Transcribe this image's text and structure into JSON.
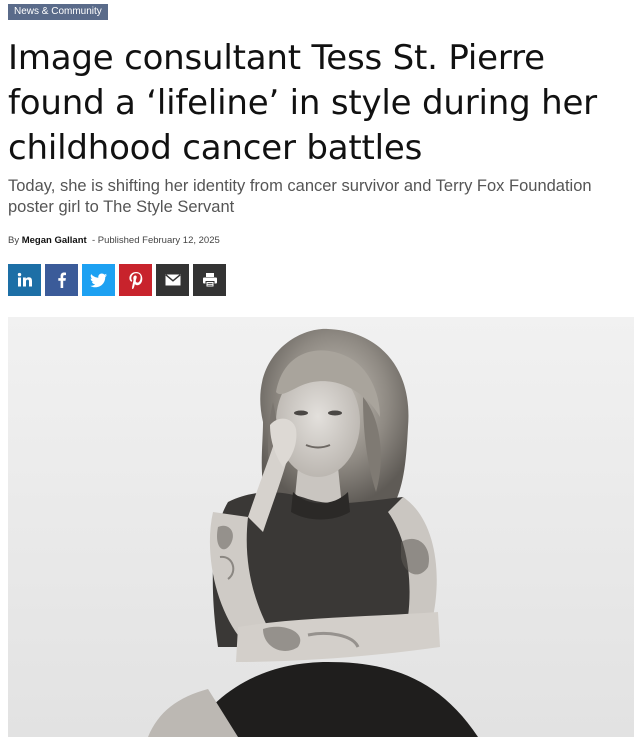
{
  "article": {
    "category": "News & Community",
    "headline": "Image consultant Tess St. Pierre found a ‘lifeline’ in style during her childhood cancer battles",
    "subheadline": "Today, she is shifting her identity from cancer survivor and Terry Fox Foundation poster girl to The Style Servant",
    "byline": {
      "by_label": "By",
      "author": "Megan Gallant",
      "separator": "-",
      "published_label": "Published",
      "date": "February 12, 2025"
    }
  },
  "share": {
    "buttons": [
      {
        "icon": "linkedin-icon",
        "color": "#1d6fa6"
      },
      {
        "icon": "facebook-icon",
        "color": "#3b5b99"
      },
      {
        "icon": "twitter-icon",
        "color": "#1da1f2"
      },
      {
        "icon": "pinterest-icon",
        "color": "#c8232c"
      },
      {
        "icon": "email-icon",
        "color": "#333333"
      },
      {
        "icon": "print-icon",
        "color": "#333333"
      }
    ]
  },
  "hero_image": {
    "style": "black-and-white portrait"
  },
  "colors": {
    "category_badge": "#5a6b8a",
    "subhead_text": "#555555"
  }
}
